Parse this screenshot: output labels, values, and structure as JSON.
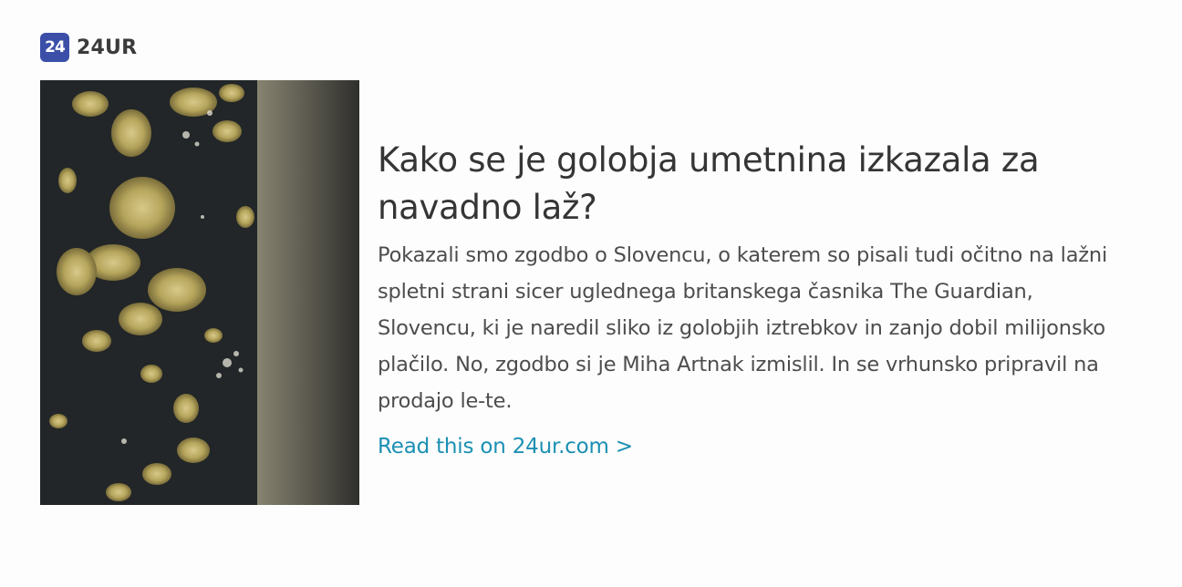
{
  "source": {
    "logo_text": "24",
    "name": "24UR",
    "logo_color": "#3b4fa8"
  },
  "article": {
    "image_icon": "pigeon-art-painting-image",
    "headline": "Kako se je golobja umetnina izkazala za navadno laž?",
    "summary": "Pokazali smo zgodbo o Slovencu, o katerem so pisali tudi očitno na lažni spletni strani sicer uglednega britanskega časnika The Guardian, Slovencu, ki je naredil sliko iz golobjih iztrebkov in zanjo dobil milijonsko plačilo. No, zgodbo si je Miha Artnak izmislil. In se vrhunsko pripravil na prodajo le-te.",
    "read_more": "Read this on 24ur.com >",
    "link_color": "#1b8fb3"
  }
}
